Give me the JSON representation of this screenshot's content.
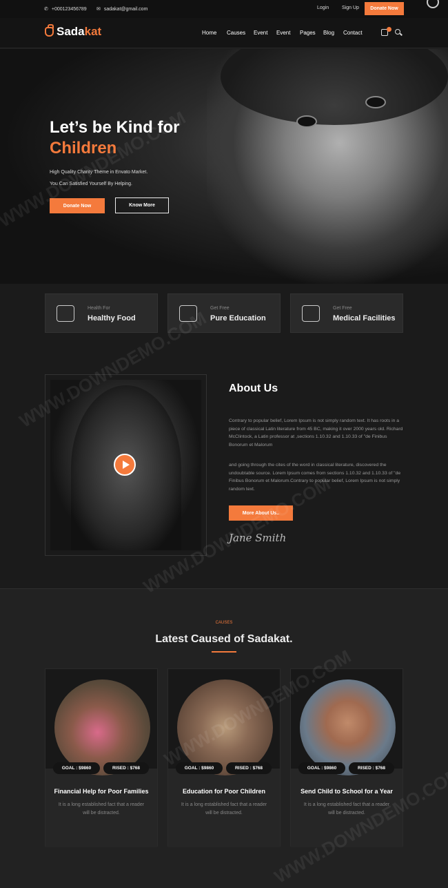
{
  "topbar": {
    "phone": "+000123456789",
    "email": "sadakat@gmail.com",
    "login": "Login",
    "signup": "Sign Up",
    "donate": "Donate Now"
  },
  "nav": {
    "logo_part1": "Sada",
    "logo_part2": "kat",
    "items": [
      "Home",
      "Causes",
      "Event",
      "Event",
      "Pages",
      "Blog",
      "Contact"
    ],
    "cart_count": "0"
  },
  "hero": {
    "title_line1": "Let’s be Kind for",
    "title_line2": "Children",
    "sub_line1": "High Quality Charity Theme in Envato Market.",
    "sub_line2": "You Can Satisfied Yourself By Helping.",
    "btn_donate": "Donate Now",
    "btn_know": "Know More"
  },
  "features": [
    {
      "small": "Health For",
      "big": "Healthy Food",
      "icon": "food-bowl-icon"
    },
    {
      "small": "Get Free",
      "big": "Pure Education",
      "icon": "backpack-icon"
    },
    {
      "small": "Get Free",
      "big": "Medical Facilities",
      "icon": "medicine-icon"
    }
  ],
  "about": {
    "title": "About Us",
    "p1": "Contrary to popular belief, Lorem Ipsum is not simply random text. It has roots in a piece of classical Latin literature from 45 BC, making it over 2000 years old. Richard McClintock, a Latin professor at ,sections 1.10.32 and 1.10.33 of \"de Finibus Bonorum et Malorum",
    "p2": "and going through the cites of the word in classical literature, discovered the undoubtable source. Lorem Ipsum comes from sections 1.10.32 and 1.10.33 of \"de Finibus Bonorum et Malorum.Contrary to popular belief, Lorem Ipsum is not simply random text.",
    "button": "More About Us..",
    "signature": "Jane Smith"
  },
  "causes": {
    "tag": "CAUSES",
    "title": "Latest Caused of Sadakat.",
    "cards": [
      {
        "goal": "GOAL : $9860",
        "raised": "RISED : $768",
        "title": "Financial Help for Poor Families",
        "desc": "It is a long established fact that a reader will be distracted."
      },
      {
        "goal": "GOAL : $9860",
        "raised": "RISED : $768",
        "title": "Education for Poor Children",
        "desc": "It is a long established fact that a reader will be distracted."
      },
      {
        "goal": "GOAL : $9860",
        "raised": "RISED : $768",
        "title": "Send Child to School for a Year",
        "desc": "It is a long established fact that a reader will be distracted."
      }
    ]
  },
  "watermark": "WWW.DOWNDEMO.COM",
  "colors": {
    "accent": "#f47a3c",
    "background": "#1b1b1b"
  }
}
